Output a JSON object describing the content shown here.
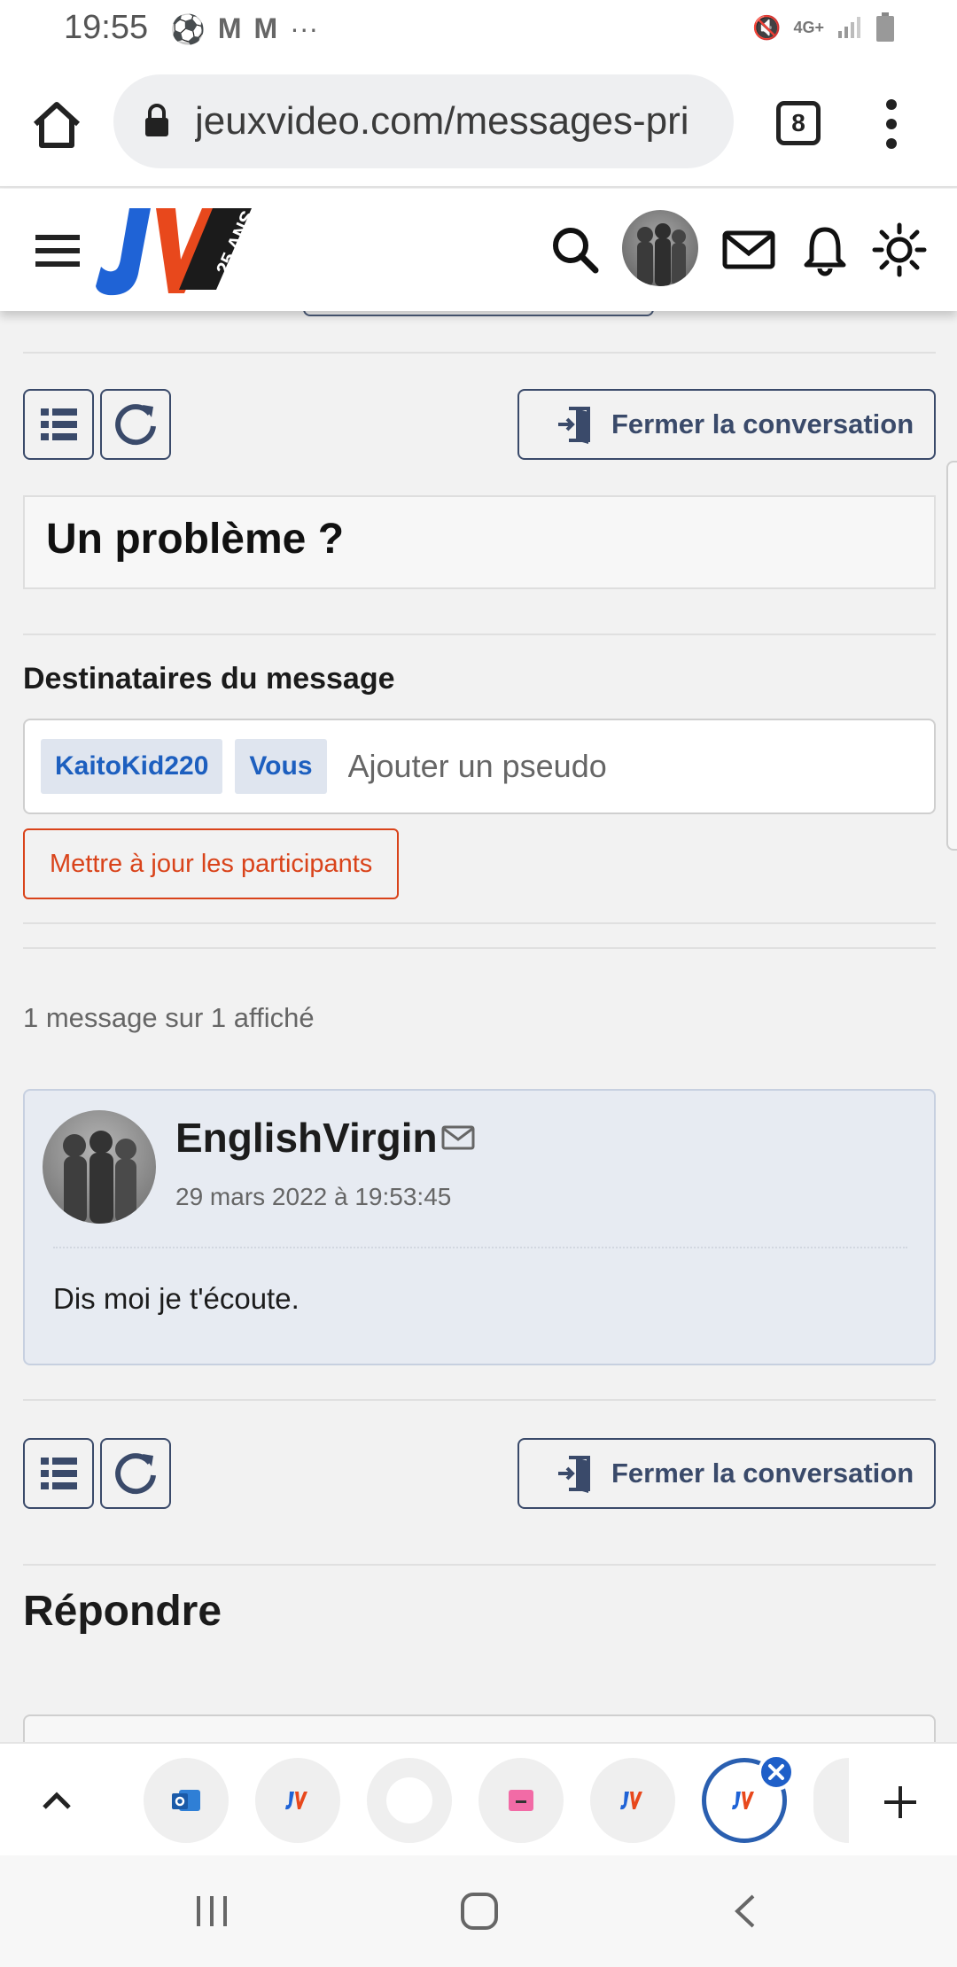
{
  "status_bar": {
    "time": "19:55",
    "network": "4G+"
  },
  "browser": {
    "url": "jeuxvideo.com/messages-pri",
    "tab_count": "8"
  },
  "conversation": {
    "close_label": "Fermer la conversation",
    "title": "Un problème ?",
    "recipients_label": "Destinataires du message",
    "recipients": [
      "KaitoKid220",
      "Vous"
    ],
    "add_placeholder": "Ajouter un pseudo",
    "update_label": "Mettre à jour les participants",
    "count_text": "1 message sur 1 affiché"
  },
  "message": {
    "author": "EnglishVirgin",
    "date": "29 mars 2022 à 19:53:45",
    "body": "Dis moi je t'écoute."
  },
  "reply": {
    "title": "Répondre"
  },
  "colors": {
    "accent_blue": "#1d5fbf",
    "update_orange": "#d9431a",
    "button_navy": "#3a4a6a"
  }
}
